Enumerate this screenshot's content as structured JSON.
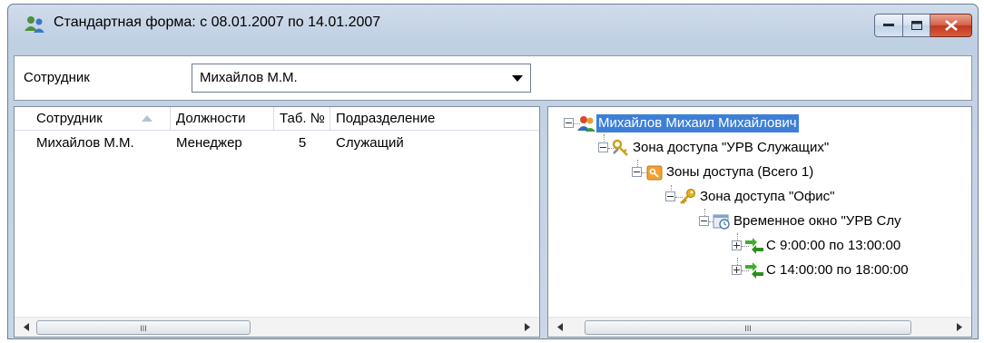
{
  "window": {
    "title": "Стандартная форма: с 08.01.2007 по 14.01.2007",
    "title_icon": "users-icon"
  },
  "filter": {
    "label": "Сотрудник",
    "selected": "Михайлов М.М."
  },
  "grid": {
    "columns": [
      "Сотрудник",
      "Должности",
      "Таб. №",
      "Подразделение"
    ],
    "sorted_column": "Сотрудник",
    "rows": [
      [
        "Михайлов М.М.",
        "Менеджер",
        "5",
        "Служащий"
      ]
    ]
  },
  "tree": {
    "nodes": [
      {
        "label": "Михайлов Михаил Михайлович",
        "icon": "users-icon",
        "selected": true
      },
      {
        "label": "Зона доступа \"УРВ Служащих\"",
        "icon": "keys-icon"
      },
      {
        "label": "Зоны доступа (Всего 1)",
        "icon": "key-folder-icon"
      },
      {
        "label": "Зона доступа \"Офис\"",
        "icon": "key-icon"
      },
      {
        "label": "Временное окно \"УРВ Слу",
        "icon": "clock-window-icon"
      },
      {
        "label": "С 9:00:00 по 13:00:00",
        "icon": "in-out-arrows-icon"
      },
      {
        "label": "С 14:00:00 по 18:00:00",
        "icon": "in-out-arrows-icon"
      }
    ]
  },
  "scrollbars": {
    "grip": "III"
  },
  "colors": {
    "selection": "#3d7fd6",
    "close_button": "#c1381d",
    "frame": "#c0d0e3"
  }
}
